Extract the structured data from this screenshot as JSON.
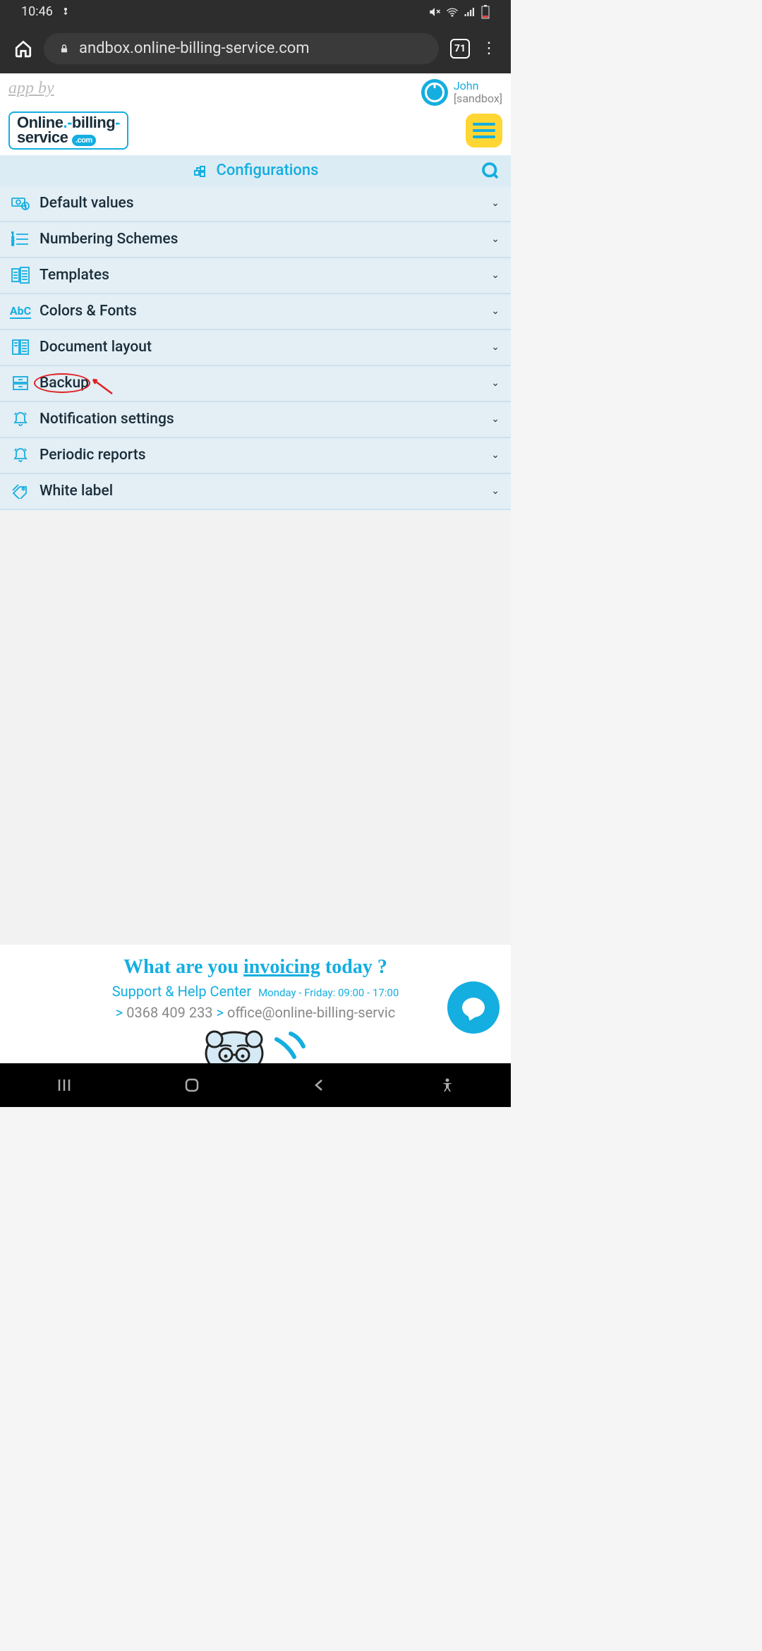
{
  "status": {
    "time": "10:46"
  },
  "browser": {
    "url": "andbox.online-billing-service.com",
    "tab_count": "71"
  },
  "header": {
    "app_by": "app by",
    "user": {
      "name": "John",
      "env": "[sandbox]"
    },
    "logo": {
      "line1_a": "Online",
      "line1_b": "billing",
      "line2": "service",
      "suffix": ".com"
    }
  },
  "section": {
    "title": "Configurations"
  },
  "menu": {
    "items": [
      {
        "label": "Default values",
        "icon": "money-coins"
      },
      {
        "label": "Numbering Schemes",
        "icon": "numbered-list"
      },
      {
        "label": "Templates",
        "icon": "templates"
      },
      {
        "label": "Colors & Fonts",
        "icon": "abc"
      },
      {
        "label": "Document layout",
        "icon": "document-layout"
      },
      {
        "label": "Backup",
        "icon": "archive",
        "highlighted": true
      },
      {
        "label": "Notification settings",
        "icon": "bell"
      },
      {
        "label": "Periodic reports",
        "icon": "bell"
      },
      {
        "label": "White label",
        "icon": "tag"
      }
    ]
  },
  "footer": {
    "headline_pre": "What are you ",
    "headline_em": "invoicing",
    "headline_post": " today ?",
    "support_label": "Support & Help Center",
    "hours": "Monday - Friday: 09:00 - 17:00",
    "phone": "0368 409 233",
    "email": "office@online-billing-servic"
  }
}
